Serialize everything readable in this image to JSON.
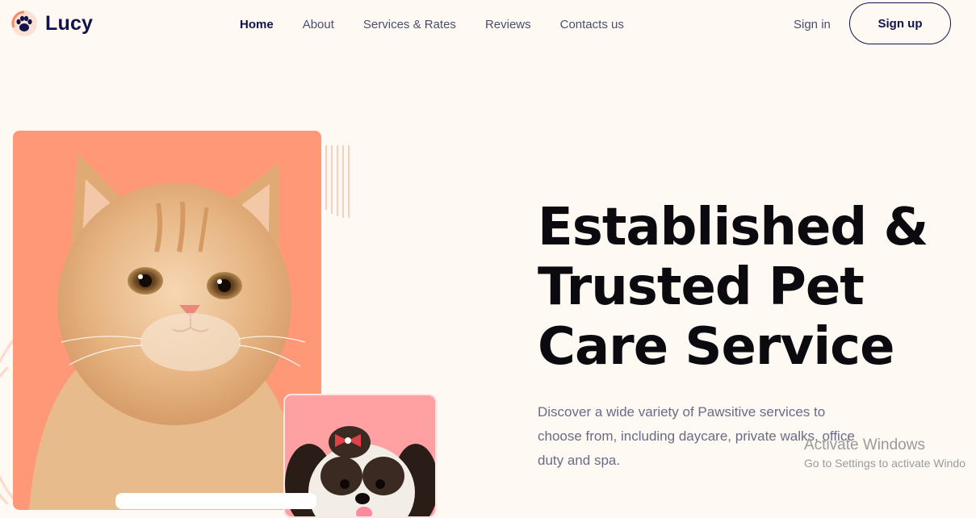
{
  "header": {
    "brand": "Lucy",
    "logo_icon": "paw-icon",
    "nav": [
      {
        "label": "Home",
        "active": true
      },
      {
        "label": "About"
      },
      {
        "label": "Services & Rates"
      },
      {
        "label": "Reviews"
      },
      {
        "label": "Contacts us"
      }
    ],
    "sign_in": "Sign in",
    "sign_up": "Sign up"
  },
  "hero": {
    "headline": [
      "Established &",
      "Trusted Pet",
      "Care Service"
    ],
    "description": "Discover a wide variety of Pawsitive services to choose from, including daycare, private walks, office duty and spa.",
    "images": [
      "orange-kitten",
      "small-dog"
    ]
  },
  "watermark": {
    "title": "Activate Windows",
    "subtitle": "Go to Settings to activate Windo"
  },
  "colors": {
    "background": "#fff9f4",
    "brand_navy": "#11134a",
    "accent_orange": "#ff9877",
    "accent_pink": "#ffa0a2"
  }
}
